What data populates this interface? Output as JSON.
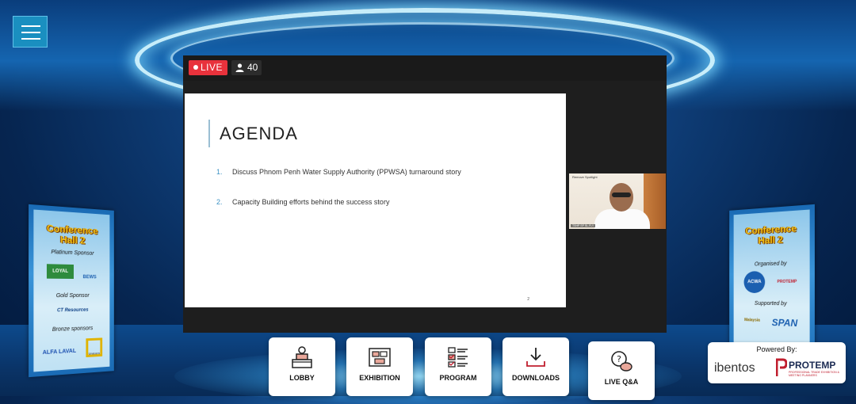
{
  "stream": {
    "live_label": "LIVE",
    "viewer_count": "40"
  },
  "slide": {
    "title": "AGENDA",
    "items": [
      {
        "num": "1.",
        "text": "Discuss Phnom Penh Water Supply Authority (PPWSA) turnaround story"
      },
      {
        "num": "2.",
        "text": "Capacity Building efforts behind the success story"
      }
    ],
    "page": "2"
  },
  "speaker_video": {
    "spotlight_label": "Remove Spotlight",
    "name_tag": "TSHP SP SL.FLY"
  },
  "left_banner": {
    "title_line1": "Conference",
    "title_line2": "Hall 2",
    "platinum": "Platinum Sponsor",
    "platinum_logos": [
      "LOYAL",
      "BEWS"
    ],
    "gold": "Gold Sponsor",
    "gold_logo": "CT Resources",
    "bronze": "Bronze sponsors",
    "bronze_logos": [
      "ALFA LAVAL",
      "Unicorn"
    ]
  },
  "right_banner": {
    "title_line1": "Conference",
    "title_line2": "Hall 2",
    "organised": "Organised by",
    "organiser_logos": [
      "ACWA",
      "PROTEMP"
    ],
    "supported": "Supported by",
    "supporter_logos": [
      "Malaysia",
      "SPAN"
    ]
  },
  "nav": [
    {
      "label": "LOBBY",
      "icon": "lobby-desk-icon"
    },
    {
      "label": "EXHIBITION",
      "icon": "exhibition-booth-icon"
    },
    {
      "label": "PROGRAM",
      "icon": "checklist-icon"
    },
    {
      "label": "DOWNLOADS",
      "icon": "download-icon"
    },
    {
      "label": "LIVE Q&A",
      "icon": "chat-question-icon"
    }
  ],
  "powered_by": {
    "label": "Powered By:",
    "brand1": "ibentos",
    "brand2": "PROTEMP",
    "brand2_sub": "PROFESSIONAL TRADE EXHIBITION & MEETING PLANNERS"
  },
  "colors": {
    "live_red": "#e8323c",
    "menu_blue": "#1a8fc0",
    "banner_title": "#f5c518"
  }
}
